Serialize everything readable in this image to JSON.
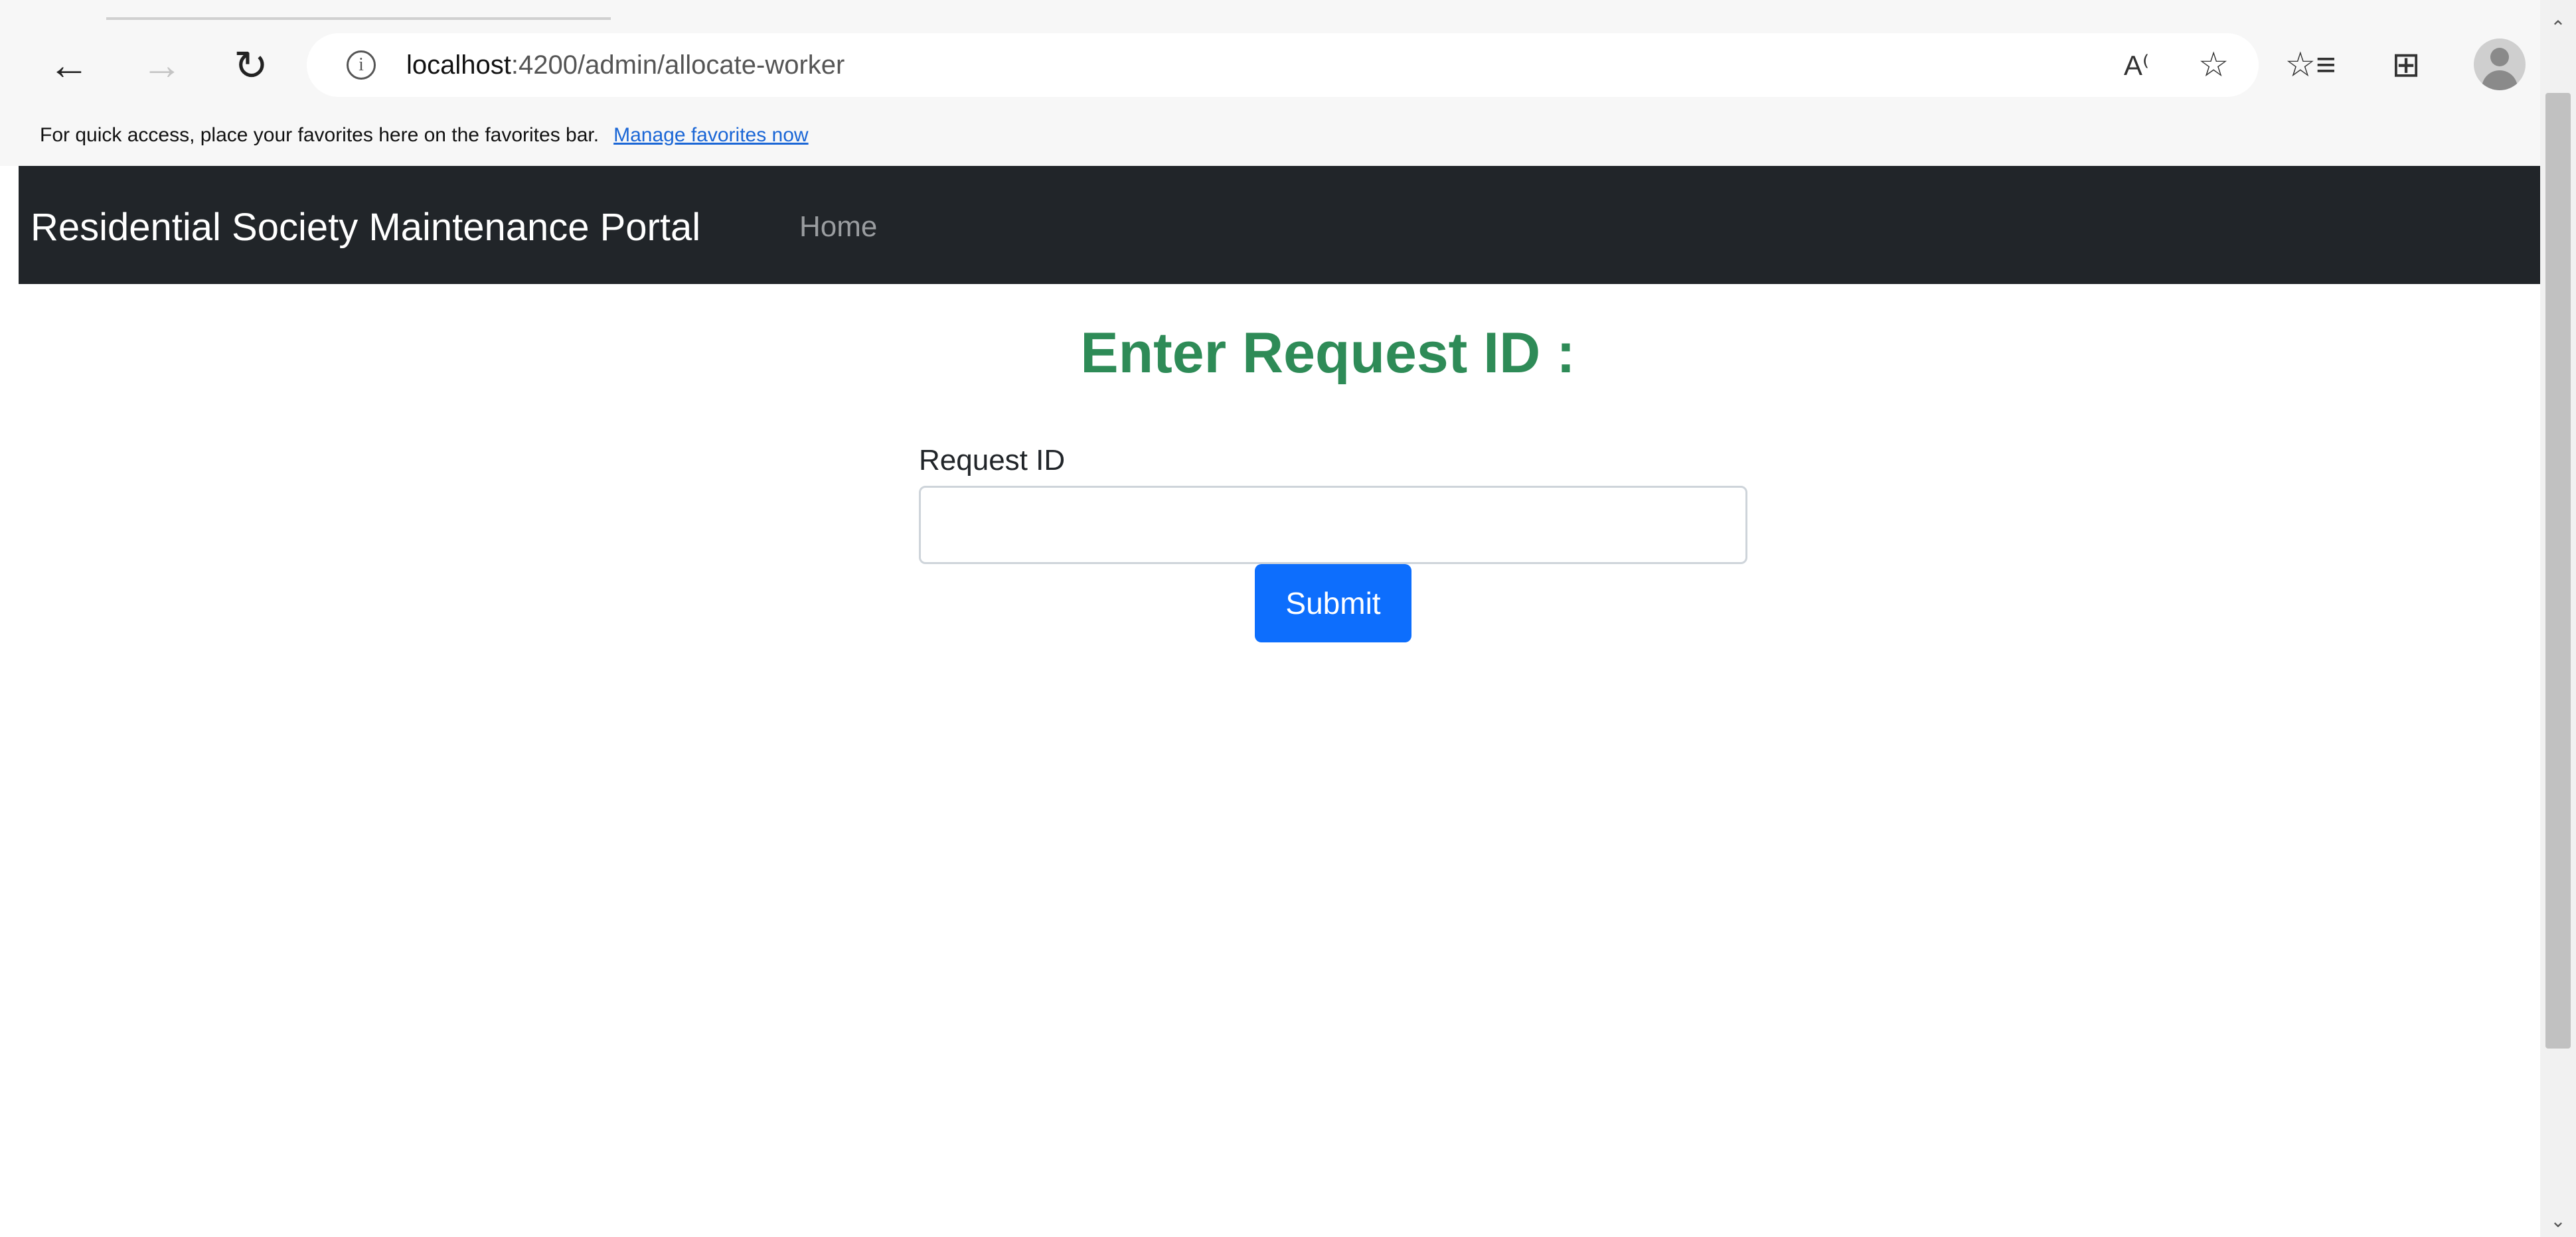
{
  "browser": {
    "url_host": "localhost",
    "url_rest": ":4200/admin/allocate-worker",
    "favorites_message": "For quick access, place your favorites here on the favorites bar.",
    "favorites_link": "Manage favorites now",
    "icons": {
      "back": "arrow-left-icon",
      "forward": "arrow-right-icon",
      "refresh": "refresh-icon",
      "info": "info-icon",
      "read_aloud": "read-aloud-icon",
      "add_favorite": "star-add-icon",
      "favorites": "favorites-icon",
      "collections": "collections-icon",
      "profile": "profile-avatar-icon"
    }
  },
  "navbar": {
    "brand": "Residential Society Maintenance Portal",
    "links": [
      "Home"
    ],
    "background": "#212529"
  },
  "main": {
    "title": "Enter Request ID :",
    "title_color": "#2e8b57",
    "form": {
      "label": "Request ID",
      "input_value": "",
      "submit_label": "Submit",
      "submit_color": "#0d6efd"
    }
  }
}
